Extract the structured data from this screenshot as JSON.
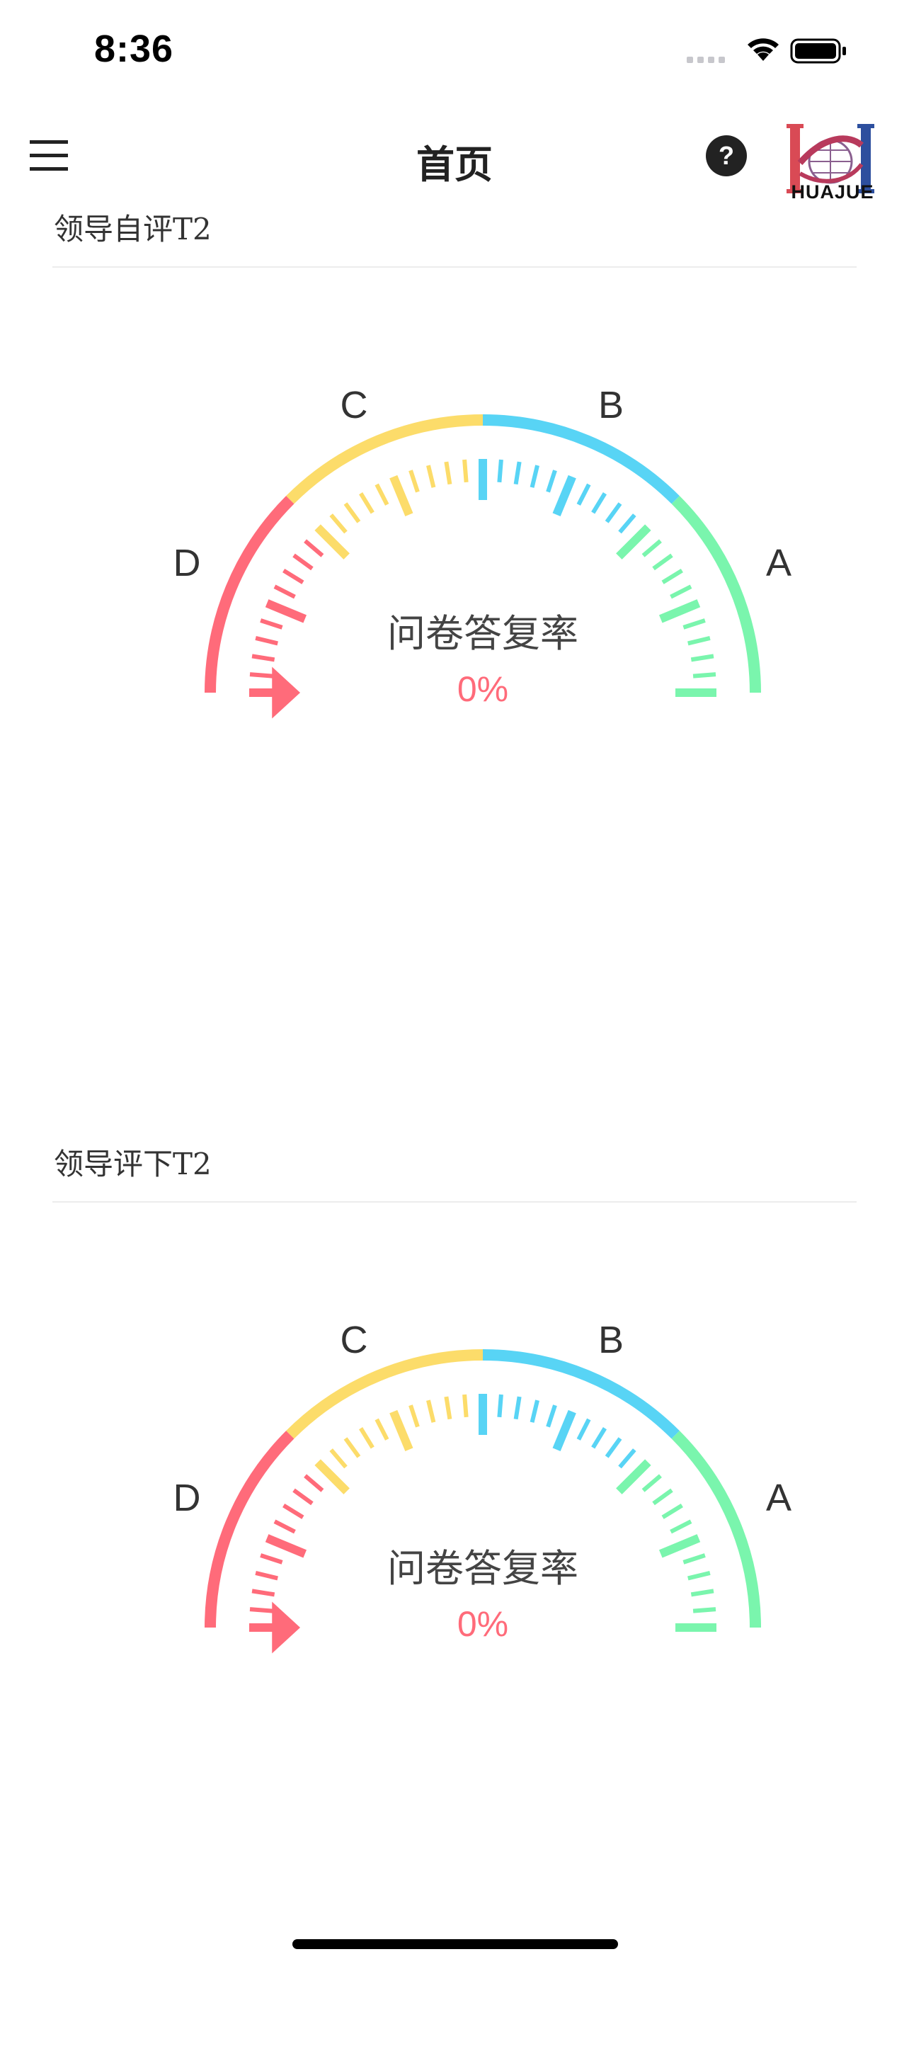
{
  "status_bar": {
    "time": "8:36",
    "signal_icon": "cellular-signal-icon",
    "wifi_icon": "wifi-icon",
    "battery_icon": "battery-icon"
  },
  "header": {
    "title": "首页",
    "menu_icon": "hamburger-menu-icon",
    "help_icon": "question-circle-icon",
    "logo_text": "HUAJUE"
  },
  "colors": {
    "red": "#ff6b7a",
    "yellow": "#fcdc6a",
    "blue": "#58d4f5",
    "green": "#7af5ad",
    "text": "#333333"
  },
  "sections": [
    {
      "title": "领导自评T2",
      "gauge": {
        "center_label": "问卷答复率",
        "value_text": "0%",
        "value": 0,
        "zone_labels": [
          "D",
          "C",
          "B",
          "A"
        ]
      }
    },
    {
      "title": "领导评下T2",
      "gauge": {
        "center_label": "问卷答复率",
        "value_text": "0%",
        "value": 0,
        "zone_labels": [
          "D",
          "C",
          "B",
          "A"
        ]
      }
    }
  ]
}
